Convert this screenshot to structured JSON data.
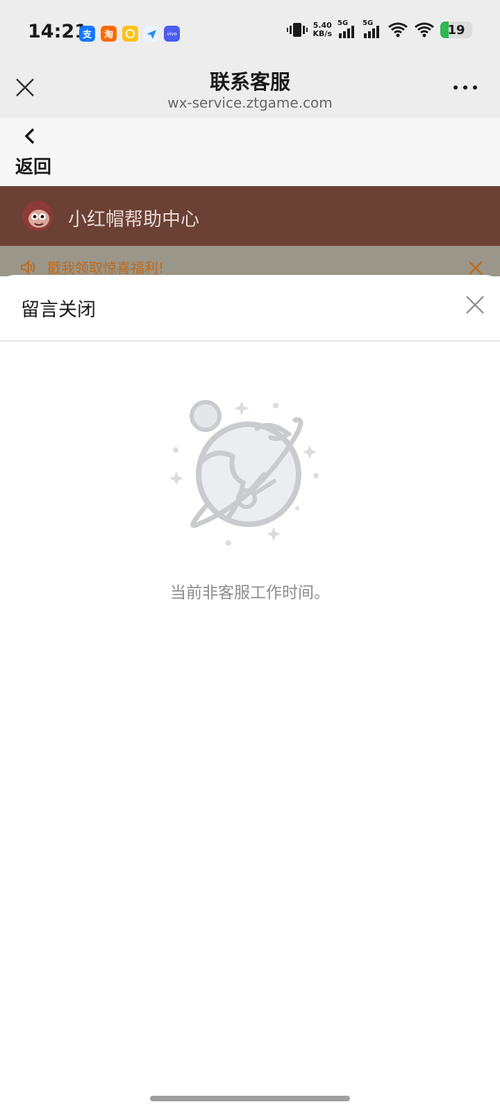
{
  "status_bar": {
    "time": "14:21",
    "app_icons": [
      {
        "name": "alipay-icon",
        "glyph": "支",
        "color": "#1677ff"
      },
      {
        "name": "taobao-icon",
        "glyph": "淘",
        "color": "#ff6a00"
      },
      {
        "name": "yellow-app-icon",
        "glyph": "",
        "color": "#ffc21a"
      },
      {
        "name": "send-app-icon",
        "glyph": "",
        "color": "#3aa0ff"
      },
      {
        "name": "vivo-icon",
        "glyph": "vivo",
        "color": "#4c5cf0"
      }
    ],
    "net_speed_value": "5.40",
    "net_speed_unit": "KB/s",
    "signal_1_label": "5G",
    "signal_2_label": "5G",
    "battery": "19"
  },
  "nav": {
    "title": "联系客服",
    "url": "wx-service.ztgame.com"
  },
  "page": {
    "back_label": "返回",
    "brand_name": "小红帽帮助中心",
    "notice_text": "戳我领取惊喜福利!"
  },
  "sheet": {
    "title": "留言关闭",
    "empty_text": "当前非客服工作时间。"
  },
  "colors": {
    "brand_bar": "#6b4135",
    "notice_text": "#c06a1b",
    "battery_level": "#2fb94f"
  }
}
